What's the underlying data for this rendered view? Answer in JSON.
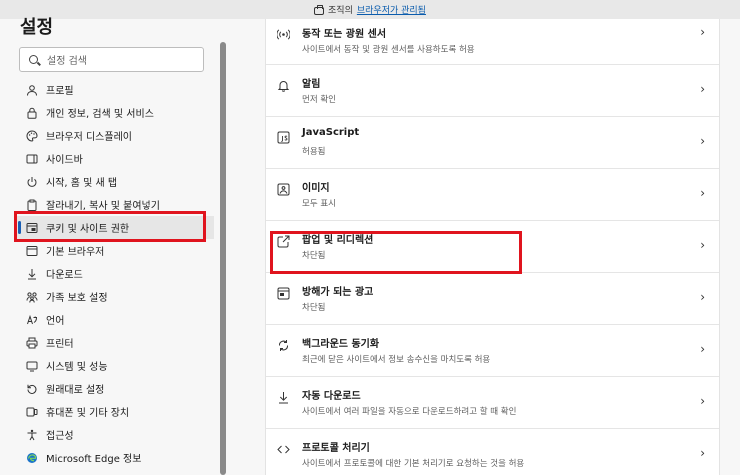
{
  "banner": {
    "prefix": "조직의",
    "link": "브라우저가 관리됨"
  },
  "sidebar": {
    "title": "설정",
    "search_placeholder": "설정 검색",
    "items": [
      {
        "label": "프로필",
        "icon": "profile-icon"
      },
      {
        "label": "개인 정보, 검색 및 서비스",
        "icon": "lock-icon"
      },
      {
        "label": "브라우저 디스플레이",
        "icon": "palette-icon"
      },
      {
        "label": "사이드바",
        "icon": "sidebar-icon"
      },
      {
        "label": "시작, 홈 및 새 탭",
        "icon": "power-icon"
      },
      {
        "label": "잘라내기, 복사 및 붙여넣기",
        "icon": "clipboard-icon"
      },
      {
        "label": "쿠키 및 사이트 권한",
        "icon": "site-permissions-icon",
        "active": true
      },
      {
        "label": "기본 브라우저",
        "icon": "browser-icon"
      },
      {
        "label": "다운로드",
        "icon": "download-icon"
      },
      {
        "label": "가족 보호 설정",
        "icon": "family-icon"
      },
      {
        "label": "언어",
        "icon": "language-icon"
      },
      {
        "label": "프린터",
        "icon": "printer-icon"
      },
      {
        "label": "시스템 및 성능",
        "icon": "system-icon"
      },
      {
        "label": "원래대로 설정",
        "icon": "reset-icon"
      },
      {
        "label": "휴대폰 및 기타 장치",
        "icon": "phone-icon"
      },
      {
        "label": "접근성",
        "icon": "accessibility-icon"
      },
      {
        "label": "Microsoft Edge 정보",
        "icon": "edge-logo-icon"
      }
    ]
  },
  "content": {
    "rows": [
      {
        "title": "동작 또는 광원 센서",
        "subtitle": "사이트에서 동작 및 광원 센서를 사용하도록 허용",
        "icon": "motion-sensor-icon"
      },
      {
        "title": "알림",
        "subtitle": "먼저 확인",
        "icon": "bell-icon"
      },
      {
        "title": "JavaScript",
        "subtitle": "허용됨",
        "icon": "javascript-icon"
      },
      {
        "title": "이미지",
        "subtitle": "모두 표시",
        "icon": "image-icon"
      },
      {
        "title": "팝업 및 리디렉션",
        "subtitle": "차단됨",
        "icon": "popup-icon"
      },
      {
        "title": "방해가 되는 광고",
        "subtitle": "차단됨",
        "icon": "ads-icon"
      },
      {
        "title": "백그라운드 동기화",
        "subtitle": "최근에 닫은 사이트에서 정보 송수신을 마치도록 허용",
        "icon": "sync-icon"
      },
      {
        "title": "자동 다운로드",
        "subtitle": "사이트에서 여러 파일을 자동으로 다운로드하려고 할 때 확인",
        "icon": "download-icon"
      },
      {
        "title": "프로토콜 처리기",
        "subtitle": "사이트에서 프로토콜에 대한 기본 처리기로 요청하는 것을 허용",
        "icon": "protocol-icon"
      }
    ]
  }
}
